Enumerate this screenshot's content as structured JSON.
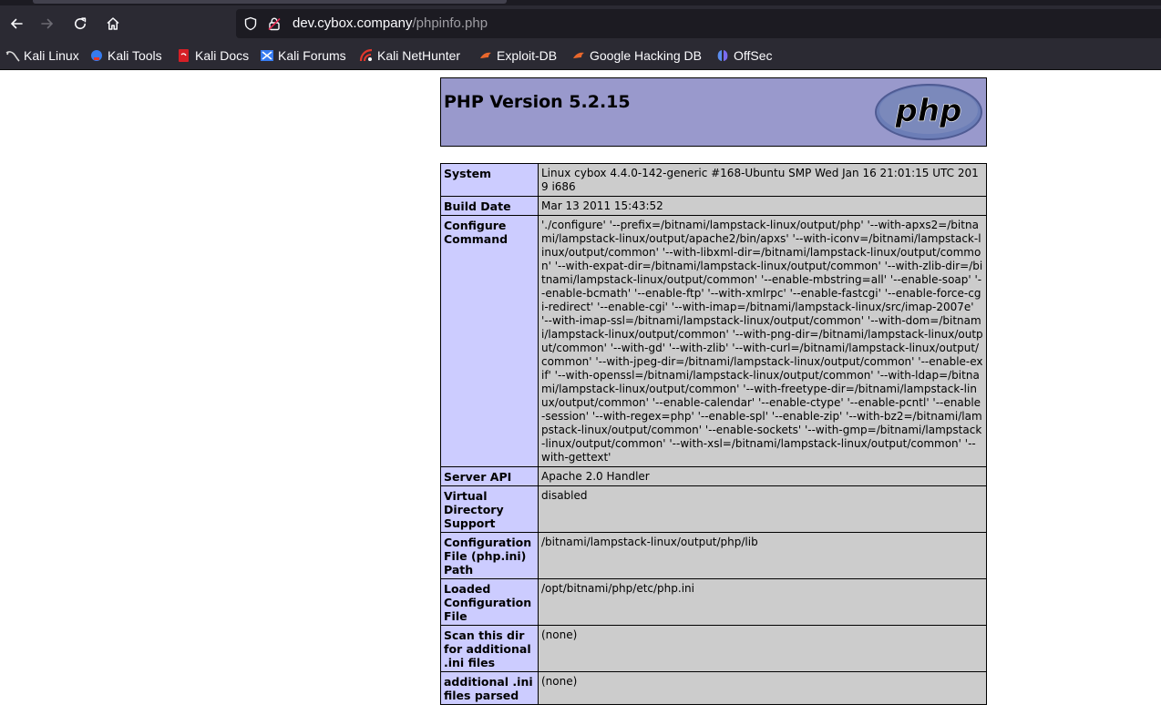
{
  "browser": {
    "url_host": "dev.cybox.company",
    "url_path": "/phpinfo.php",
    "bookmarks": [
      {
        "label": "Kali Linux",
        "icon": "kali-dragon-icon"
      },
      {
        "label": "Kali Tools",
        "icon": "kali-tools-icon"
      },
      {
        "label": "Kali Docs",
        "icon": "kali-docs-icon"
      },
      {
        "label": "Kali Forums",
        "icon": "kali-forums-icon"
      },
      {
        "label": "Kali NetHunter",
        "icon": "kali-nethunter-icon"
      },
      {
        "label": "Exploit-DB",
        "icon": "exploit-db-icon"
      },
      {
        "label": "Google Hacking DB",
        "icon": "ghdb-icon"
      },
      {
        "label": "OffSec",
        "icon": "offsec-icon"
      }
    ]
  },
  "php": {
    "title": "PHP Version 5.2.15",
    "logo_text": "php",
    "rows": [
      {
        "key": "System",
        "value": "Linux cybox 4.4.0-142-generic #168-Ubuntu SMP Wed Jan 16 21:01:15 UTC 2019 i686"
      },
      {
        "key": "Build Date",
        "value": "Mar 13 2011 15:43:52"
      },
      {
        "key": "Configure Command",
        "value": "'./configure' '--prefix=/bitnami/lampstack-linux/output/php' '--with-apxs2=/bitnami/lampstack-linux/output/apache2/bin/apxs' '--with-iconv=/bitnami/lampstack-linux/output/common' '--with-libxml-dir=/bitnami/lampstack-linux/output/common' '--with-expat-dir=/bitnami/lampstack-linux/output/common' '--with-zlib-dir=/bitnami/lampstack-linux/output/common' '--enable-mbstring=all' '--enable-soap' '--enable-bcmath' '--enable-ftp' '--with-xmlrpc' '--enable-fastcgi' '--enable-force-cgi-redirect' '--enable-cgi' '--with-imap=/bitnami/lampstack-linux/src/imap-2007e' '--with-imap-ssl=/bitnami/lampstack-linux/output/common' '--with-dom=/bitnami/lampstack-linux/output/common' '--with-png-dir=/bitnami/lampstack-linux/output/common' '--with-gd' '--with-zlib' '--with-curl=/bitnami/lampstack-linux/output/common' '--with-jpeg-dir=/bitnami/lampstack-linux/output/common' '--enable-exif' '--with-openssl=/bitnami/lampstack-linux/output/common' '--with-ldap=/bitnami/lampstack-linux/output/common' '--with-freetype-dir=/bitnami/lampstack-linux/output/common' '--enable-calendar' '--enable-ctype' '--enable-pcntl' '--enable-session' '--with-regex=php' '--enable-spl' '--enable-zip' '--with-bz2=/bitnami/lampstack-linux/output/common' '--enable-sockets' '--with-gmp=/bitnami/lampstack-linux/output/common' '--with-xsl=/bitnami/lampstack-linux/output/common' '--with-gettext'"
      },
      {
        "key": "Server API",
        "value": "Apache 2.0 Handler"
      },
      {
        "key": "Virtual Directory Support",
        "value": "disabled"
      },
      {
        "key": "Configuration File (php.ini) Path",
        "value": "/bitnami/lampstack-linux/output/php/lib"
      },
      {
        "key": "Loaded Configuration File",
        "value": "/opt/bitnami/php/etc/php.ini"
      },
      {
        "key": "Scan this dir for additional .ini files",
        "value": "(none)"
      },
      {
        "key": "additional .ini files parsed",
        "value": "(none)"
      }
    ]
  }
}
